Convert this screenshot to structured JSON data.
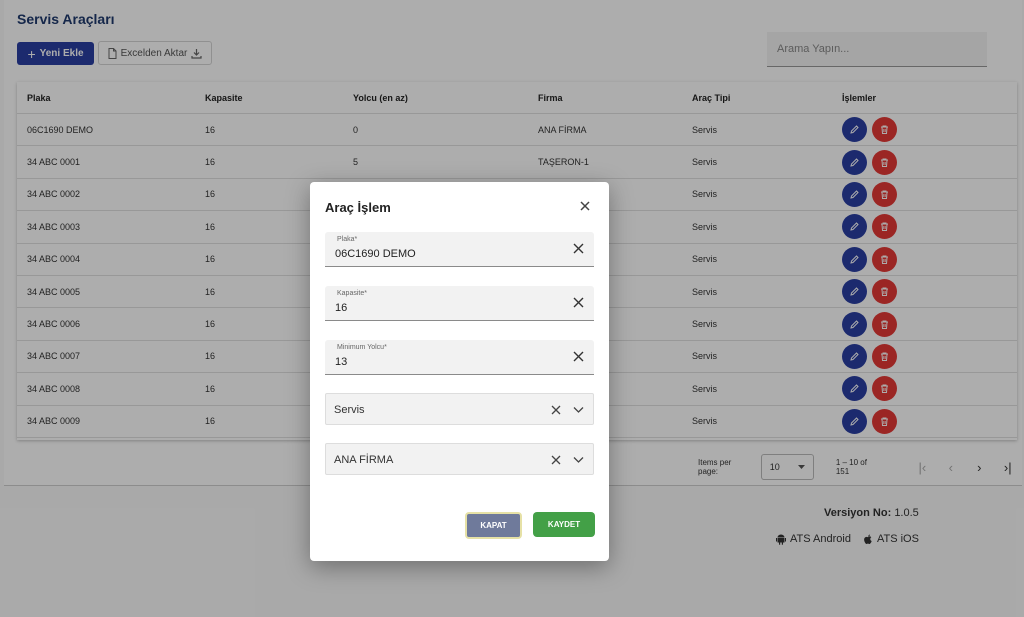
{
  "page": {
    "title": "Servis Araçları",
    "add_button": "Yeni Ekle",
    "excel_button": "Excelden Aktar",
    "search_placeholder": "Arama Yapın..."
  },
  "table": {
    "headers": [
      "Plaka",
      "Kapasite",
      "Yolcu (en az)",
      "Firma",
      "Araç Tipi",
      "İşlemler"
    ],
    "rows": [
      [
        "06C1690 DEMO",
        "16",
        "0",
        "ANA FİRMA",
        "Servis"
      ],
      [
        "34 ABC 0001",
        "16",
        "5",
        "TAŞERON-1",
        "Servis"
      ],
      [
        "34 ABC 0002",
        "16",
        "",
        "",
        "Servis"
      ],
      [
        "34 ABC 0003",
        "16",
        "",
        "",
        "Servis"
      ],
      [
        "34 ABC 0004",
        "16",
        "",
        "",
        "Servis"
      ],
      [
        "34 ABC 0005",
        "16",
        "",
        "",
        "Servis"
      ],
      [
        "34 ABC 0006",
        "16",
        "",
        "",
        "Servis"
      ],
      [
        "34 ABC 0007",
        "16",
        "",
        "",
        "Servis"
      ],
      [
        "34 ABC 0008",
        "16",
        "",
        "",
        "Servis"
      ],
      [
        "34 ABC 0009",
        "16",
        "",
        "",
        "Servis"
      ]
    ]
  },
  "paginator": {
    "items_per_page_label": "Items per page:",
    "page_size": "10",
    "range": "1 – 10 of 151"
  },
  "footer": {
    "version_label": "Versiyon No:",
    "version": "1.0.5",
    "android": "ATS Android",
    "ios": "ATS iOS"
  },
  "dialog": {
    "title": "Araç İşlem",
    "plaka_label": "Plaka*",
    "plaka_value": "06C1690 DEMO",
    "kapasite_label": "Kapasite*",
    "kapasite_value": "16",
    "min_yolcu_label": "Minimum Yolcu*",
    "min_yolcu_value": "13",
    "arac_tipi": "Servis",
    "firma": "ANA FİRMA",
    "kapat": "KAPAT",
    "kaydet": "KAYDET"
  },
  "colors": {
    "primary": "#2a3ea3",
    "danger": "#e53935",
    "success": "#43a047",
    "title": "#1f3a6e"
  }
}
